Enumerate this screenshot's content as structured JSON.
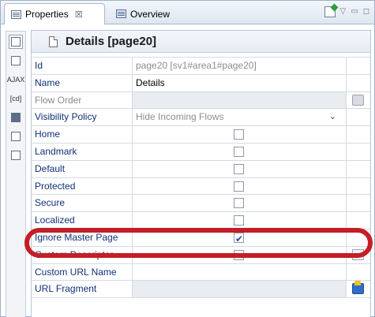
{
  "tabs": [
    {
      "label": "Properties",
      "close": "☒",
      "active": true
    },
    {
      "label": "Overview",
      "active": false
    }
  ],
  "header": {
    "title": "Details [page20]"
  },
  "properties": {
    "id": {
      "label": "Id",
      "value": "page20  [sv1#area1#page20]"
    },
    "name": {
      "label": "Name",
      "value": "Details"
    },
    "flow_order": {
      "label": "Flow Order",
      "value": ""
    },
    "visibility_policy": {
      "label": "Visibility Policy",
      "value": "Hide Incoming Flows"
    },
    "home": {
      "label": "Home",
      "checked": false
    },
    "landmark": {
      "label": "Landmark",
      "checked": false
    },
    "default": {
      "label": "Default",
      "checked": false
    },
    "protected": {
      "label": "Protected",
      "checked": false
    },
    "secure": {
      "label": "Secure",
      "checked": false
    },
    "localized": {
      "label": "Localized",
      "checked": false
    },
    "ignore_master_page": {
      "label": "Ignore Master Page",
      "checked": true
    },
    "custom_descriptor": {
      "label": "Custom Descriptor",
      "checked": false
    },
    "custom_url_name": {
      "label": "Custom URL Name",
      "value": ""
    },
    "url_fragment": {
      "label": "URL Fragment",
      "value": ""
    }
  },
  "left_toolbar": {
    "ajax_label": "AJAX",
    "code_label": "[cd]"
  },
  "colors": {
    "highlight": "#c41e26",
    "label": "#10307a",
    "check": "#1e4f9c"
  }
}
